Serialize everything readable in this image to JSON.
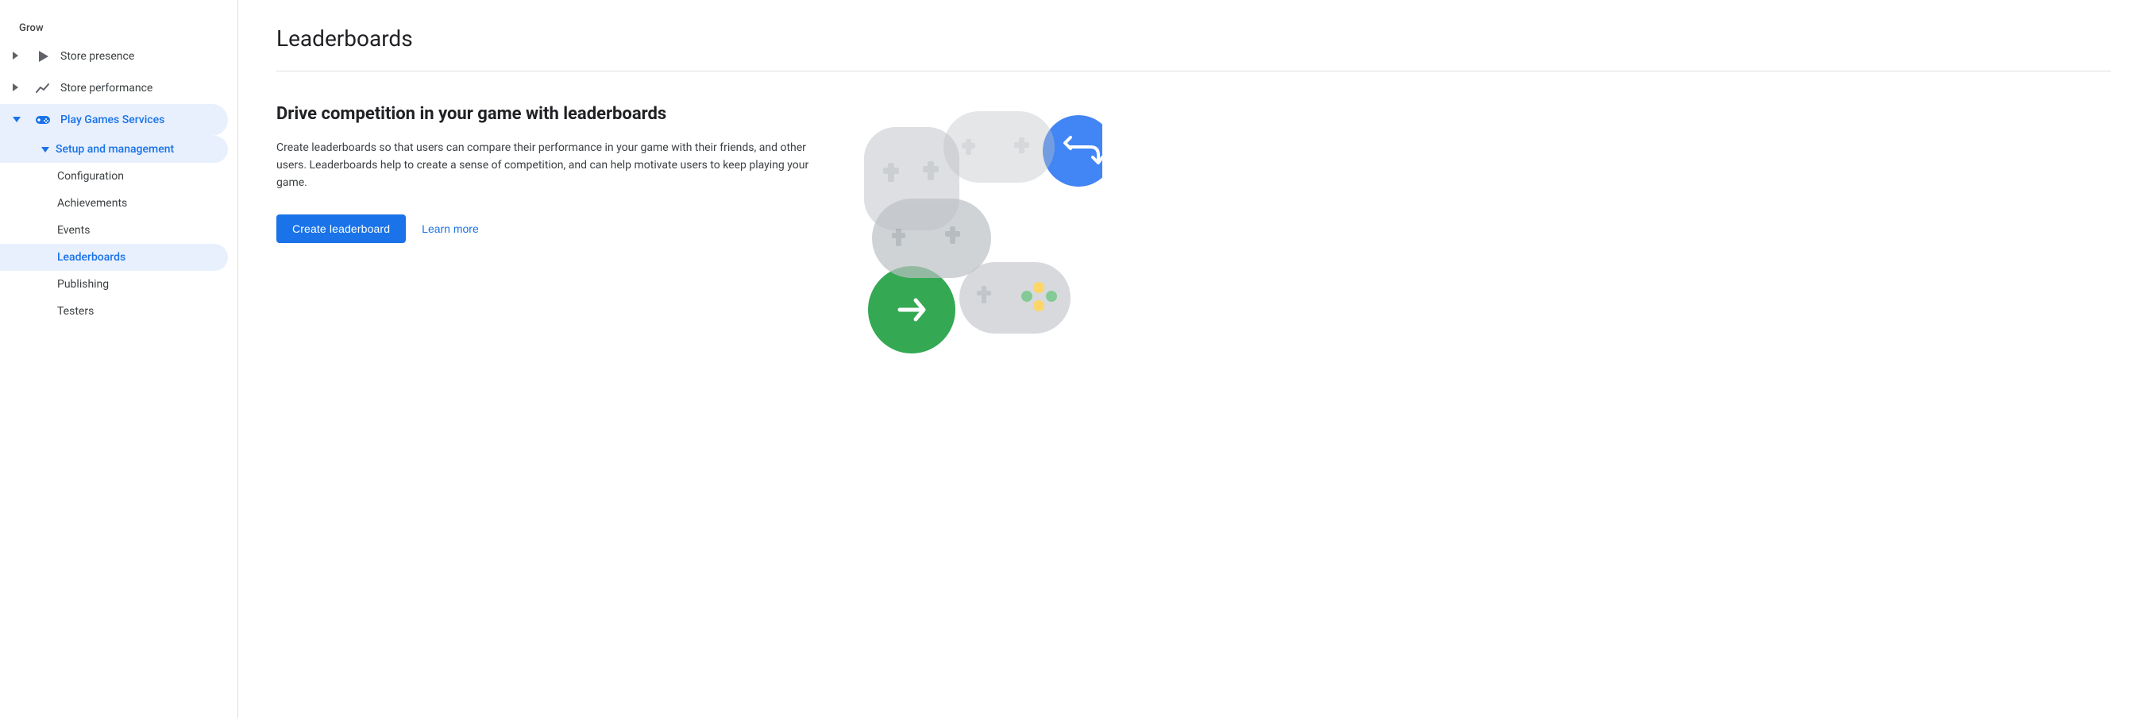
{
  "sidebar": {
    "grow_label": "Grow",
    "items": [
      {
        "id": "store-presence",
        "label": "Store presence",
        "icon": "play-triangle",
        "expandable": true,
        "expanded": false,
        "level": 0
      },
      {
        "id": "store-performance",
        "label": "Store performance",
        "icon": "chart",
        "expandable": true,
        "expanded": false,
        "level": 0
      },
      {
        "id": "play-games-services",
        "label": "Play Games Services",
        "icon": "gamepad",
        "expandable": true,
        "expanded": true,
        "active": true,
        "level": 0
      }
    ],
    "sub_items": [
      {
        "id": "setup-management",
        "label": "Setup and management",
        "parent": "play-games-services",
        "expandable": true,
        "expanded": true,
        "active": true,
        "level": 1
      }
    ],
    "subsub_items": [
      {
        "id": "configuration",
        "label": "Configuration",
        "parent": "setup-management",
        "level": 2
      },
      {
        "id": "achievements",
        "label": "Achievements",
        "parent": "setup-management",
        "level": 2
      },
      {
        "id": "events",
        "label": "Events",
        "parent": "setup-management",
        "level": 2
      },
      {
        "id": "leaderboards",
        "label": "Leaderboards",
        "parent": "setup-management",
        "level": 2,
        "active": true
      },
      {
        "id": "publishing",
        "label": "Publishing",
        "parent": "setup-management",
        "level": 2
      },
      {
        "id": "testers",
        "label": "Testers",
        "parent": "setup-management",
        "level": 2
      }
    ]
  },
  "page": {
    "title": "Leaderboards",
    "headline": "Drive competition in your game with leaderboards",
    "description": "Create leaderboards so that users can compare their performance in your game with their friends, and other users. Leaderboards help to create a sense of competition, and can help motivate users to keep playing your game.",
    "create_button_label": "Create leaderboard",
    "learn_more_label": "Learn more"
  },
  "colors": {
    "primary_blue": "#1a73e8",
    "active_bg": "#e8f0fe",
    "text_primary": "#202124",
    "text_secondary": "#3c4043",
    "divider": "#e0e0e0",
    "sidebar_icon": "#5f6368",
    "green": "#34a853",
    "yellow": "#fbbc04",
    "blue_circle": "#4285f4",
    "controller_gray": "#bdc1c6"
  }
}
